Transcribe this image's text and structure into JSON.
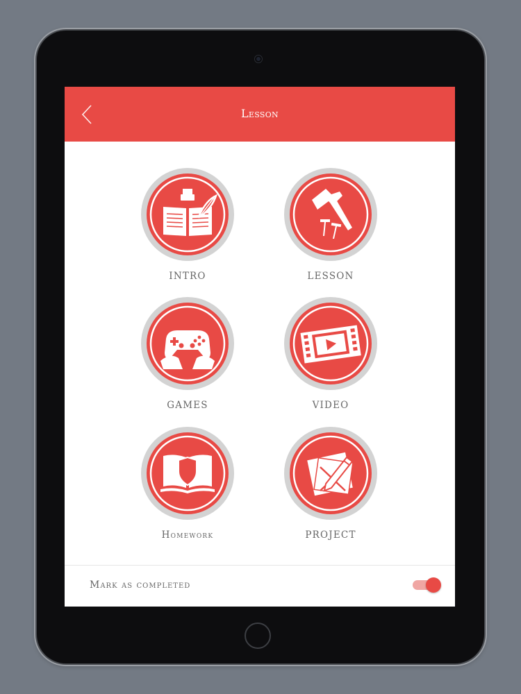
{
  "header": {
    "title": "Lesson",
    "back_icon": "chevron-left-icon"
  },
  "menu": {
    "items": [
      {
        "label": "INTRO",
        "icon": "book-quill-icon"
      },
      {
        "label": "LESSON",
        "icon": "hammer-nails-icon"
      },
      {
        "label": "GAMES",
        "icon": "gamepad-icon"
      },
      {
        "label": "VIDEO",
        "icon": "film-play-icon"
      },
      {
        "label": "Homework",
        "icon": "book-shield-icon"
      },
      {
        "label": "PROJECT",
        "icon": "pencil-paper-icon"
      }
    ]
  },
  "footer": {
    "label": "Mark as completed",
    "completed": true
  },
  "colors": {
    "accent": "#e84a45",
    "ring": "#d3d3d3",
    "background": "#737a84"
  }
}
